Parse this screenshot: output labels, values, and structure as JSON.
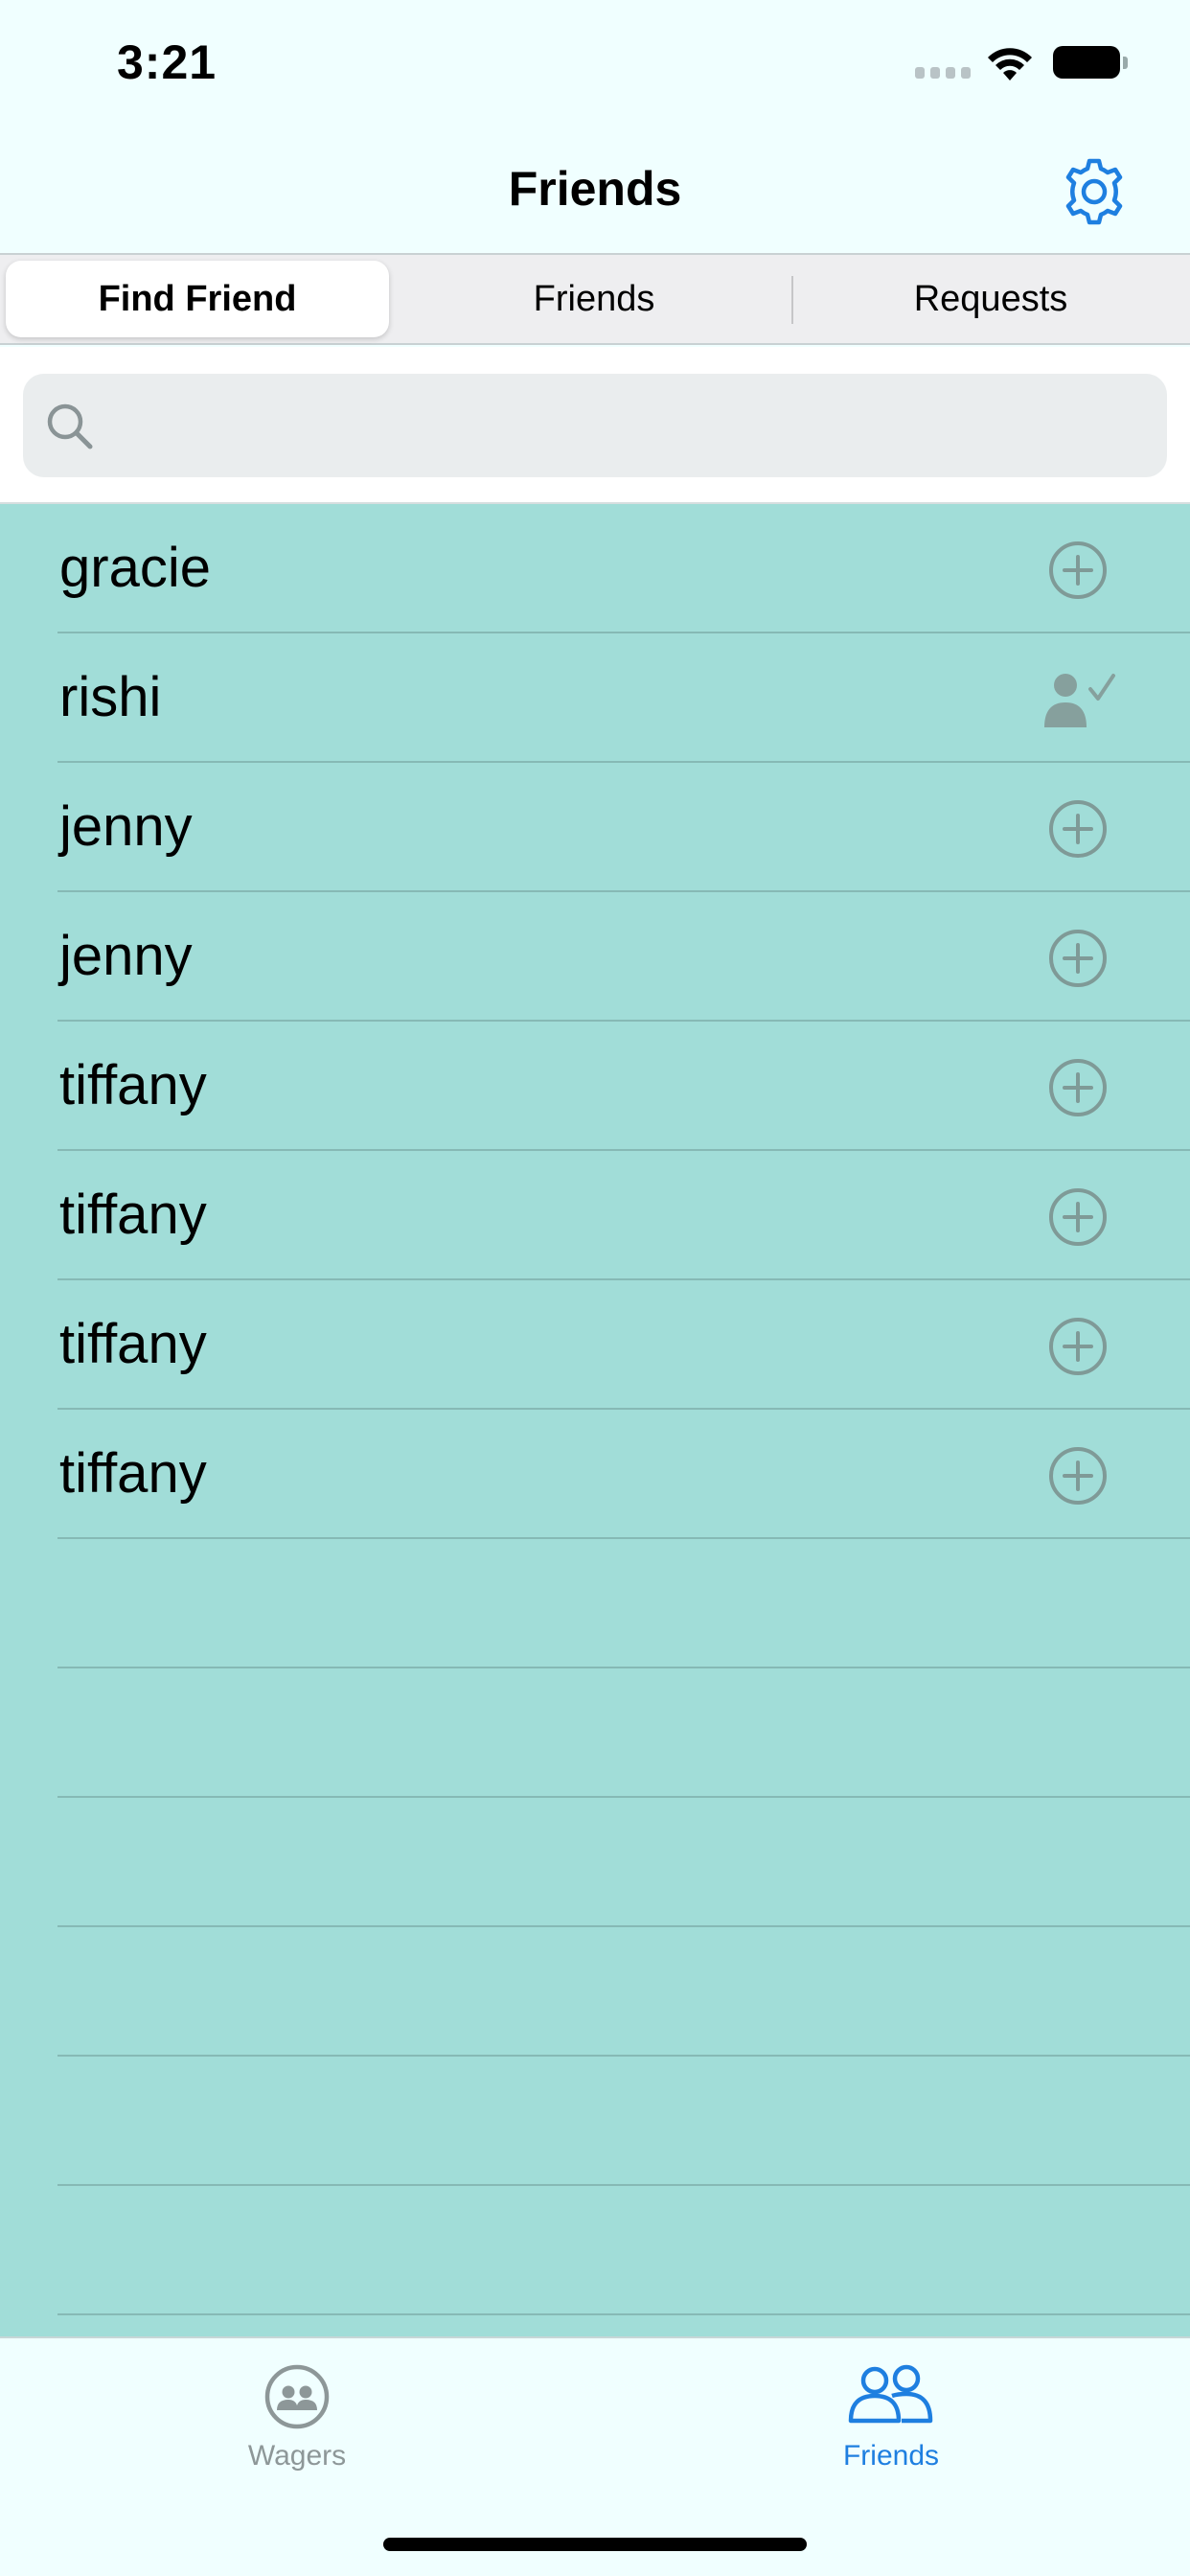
{
  "status_bar": {
    "time": "3:21"
  },
  "nav": {
    "title": "Friends"
  },
  "segmented": {
    "options": [
      "Find Friend",
      "Friends",
      "Requests"
    ],
    "selected": "Find Friend"
  },
  "search": {
    "value": "",
    "placeholder": ""
  },
  "users": [
    {
      "name": "gracie",
      "action": "add-friend"
    },
    {
      "name": "rishi",
      "action": "already-friend"
    },
    {
      "name": "jenny",
      "action": "add-friend"
    },
    {
      "name": "jenny",
      "action": "add-friend"
    },
    {
      "name": "tiffany",
      "action": "add-friend"
    },
    {
      "name": "tiffany",
      "action": "add-friend"
    },
    {
      "name": "tiffany",
      "action": "add-friend"
    },
    {
      "name": "tiffany",
      "action": "add-friend"
    }
  ],
  "empty_rows": 6,
  "tabbar": {
    "items": [
      {
        "label": "Wagers",
        "icon": "wagers-icon",
        "active": false
      },
      {
        "label": "Friends",
        "icon": "friends-icon",
        "active": true
      }
    ]
  },
  "colors": {
    "background": "#F0FFFF",
    "list_background": "#A1DDD8",
    "accent": "#1E7FE0",
    "icon_gray": "#7F9A97"
  }
}
